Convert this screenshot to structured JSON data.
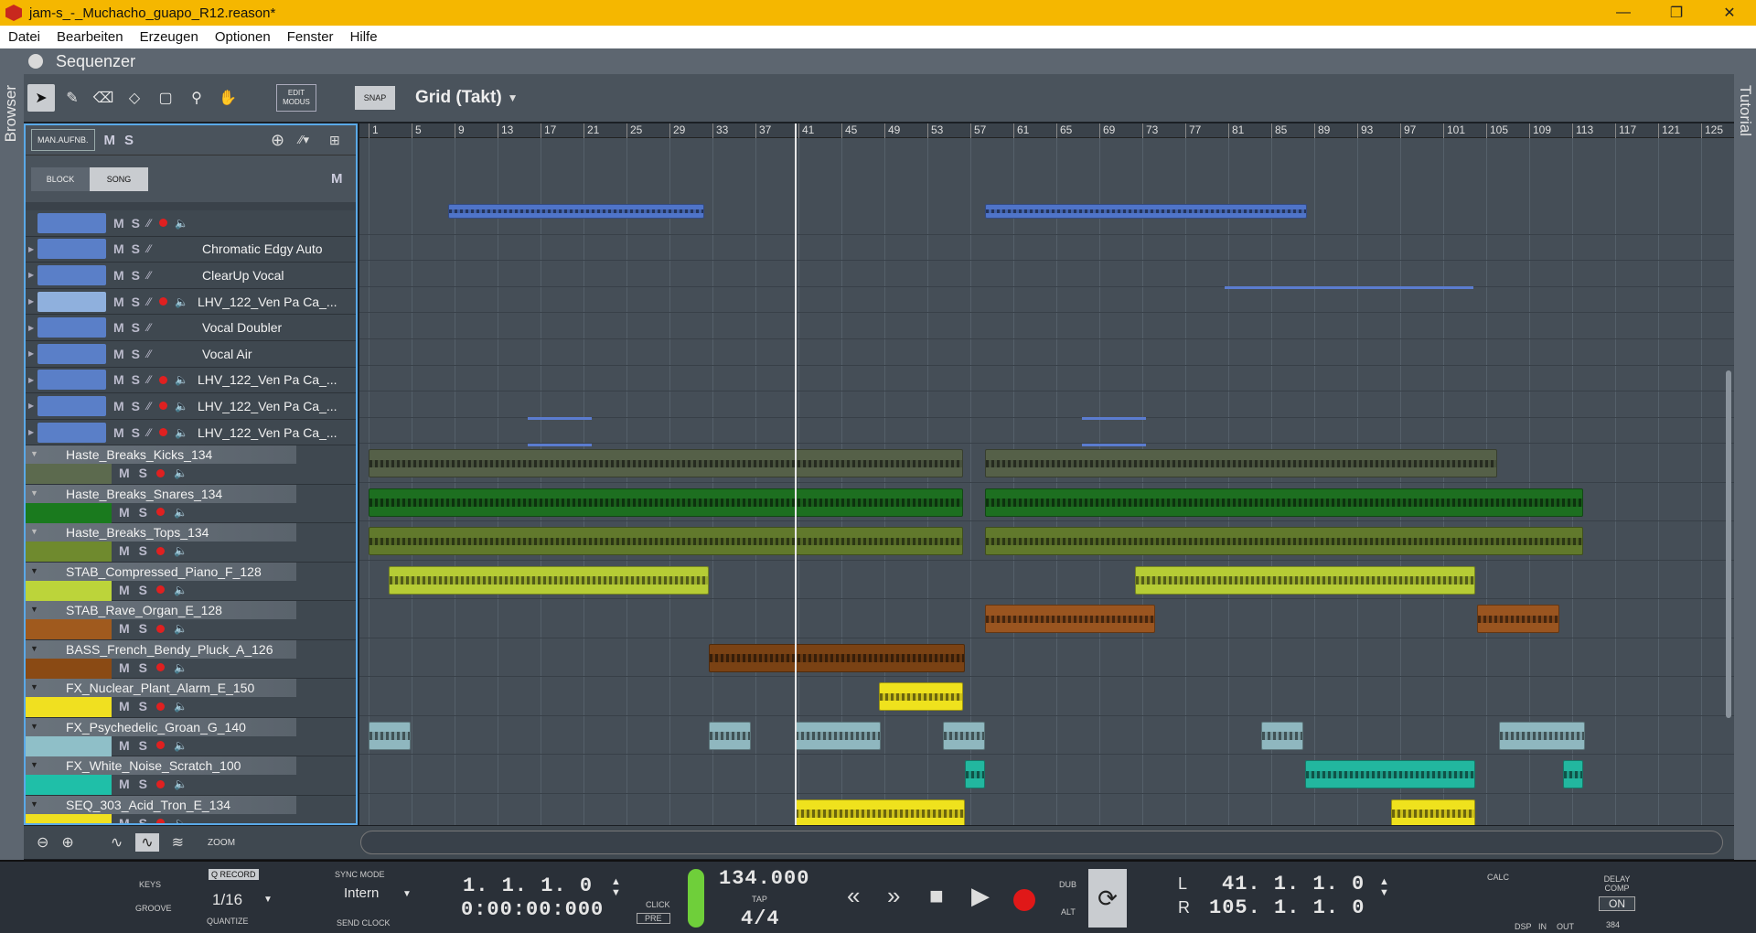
{
  "window": {
    "title": "jam-s_-_Muchacho_guapo_R12.reason*",
    "controls": [
      "—",
      "❐",
      "✕"
    ]
  },
  "menu": [
    "Datei",
    "Bearbeiten",
    "Erzeugen",
    "Optionen",
    "Fenster",
    "Hilfe"
  ],
  "side": {
    "left": "Browser",
    "right": "Tutorial"
  },
  "sequencer": {
    "title": "Sequenzer",
    "edit_mode": "EDIT MODUS",
    "snap": "SNAP",
    "grid": "Grid (Takt)"
  },
  "trackpanel": {
    "man_rec": "MAN.AUFNB.",
    "block": "BLOCK",
    "song": "SONG",
    "m": "M",
    "s": "S"
  },
  "tracks": [
    {
      "name": "",
      "color": "#5a7fc8",
      "type": "inst"
    },
    {
      "name": "Chromatic Edgy Auto",
      "color": "#5a7fc8",
      "type": "fx"
    },
    {
      "name": "ClearUp Vocal",
      "color": "#5a7fc8",
      "type": "fx"
    },
    {
      "name": "LHV_122_Ven Pa Ca_...",
      "color": "#8fb0dd",
      "type": "inst"
    },
    {
      "name": "Vocal Doubler",
      "color": "#5a7fc8",
      "type": "fx"
    },
    {
      "name": "Vocal Air",
      "color": "#5a7fc8",
      "type": "fx"
    },
    {
      "name": "LHV_122_Ven Pa Ca_...",
      "color": "#5a7fc8",
      "type": "inst"
    },
    {
      "name": "LHV_122_Ven Pa Ca_...",
      "color": "#5a7fc8",
      "type": "inst"
    },
    {
      "name": "LHV_122_Ven Pa Ca_...",
      "color": "#5a7fc8",
      "type": "inst"
    }
  ],
  "audio_tracks": [
    {
      "name": "Haste_Breaks_Kicks_134",
      "color": "#5c6a4e"
    },
    {
      "name": "Haste_Breaks_Snares_134",
      "color": "#1a7a1e"
    },
    {
      "name": "Haste_Breaks_Tops_134",
      "color": "#6f8a2e"
    },
    {
      "name": "STAB_Compressed_Piano_F_128",
      "color": "#bcd43a"
    },
    {
      "name": "STAB_Rave_Organ_E_128",
      "color": "#a05a1e"
    },
    {
      "name": "BASS_French_Bendy_Pluck_A_126",
      "color": "#8a4a14"
    },
    {
      "name": "FX_Nuclear_Plant_Alarm_E_150",
      "color": "#f0e020"
    },
    {
      "name": "FX_Psychedelic_Groan_G_140",
      "color": "#8fbfc8"
    },
    {
      "name": "FX_White_Noise_Scratch_100",
      "color": "#1fbfa8"
    },
    {
      "name": "SEQ_303_Acid_Tron_E_134",
      "color": "#f0e020"
    }
  ],
  "ruler": [
    "1",
    "5",
    "9",
    "13",
    "17",
    "21",
    "25",
    "29",
    "33",
    "37",
    "41",
    "45",
    "49",
    "53",
    "57",
    "61",
    "65",
    "69",
    "73",
    "77",
    "81",
    "85",
    "89",
    "93",
    "97",
    "101",
    "105",
    "109",
    "113",
    "117",
    "121",
    "125"
  ],
  "zoom_label": "ZOOM",
  "transport": {
    "keys": "KEYS",
    "groove": "GROOVE",
    "qrecord": "Q RECORD",
    "quantize_value": "1/16",
    "quantize": "QUANTIZE",
    "sync_mode": "SYNC MODE",
    "sync_value": "Intern",
    "send_clock": "SEND CLOCK",
    "position_bars": "1.  1.  1.    0",
    "position_time": "0:00:00:000",
    "click": "CLICK",
    "pre": "PRE",
    "tempo": "134.000",
    "tap": "TAP",
    "signature": "4/4",
    "dub": "DUB",
    "alt": "ALT",
    "loop_l_label": "L",
    "loop_l": "41.  1.  1.    0",
    "loop_r_label": "R",
    "loop_r": "105.  1.  1.    0",
    "calc": "CALC",
    "dsp": "DSP",
    "in": "IN",
    "out": "OUT",
    "delay_comp": "DELAY COMP",
    "on": "ON",
    "delay_value": "384"
  }
}
